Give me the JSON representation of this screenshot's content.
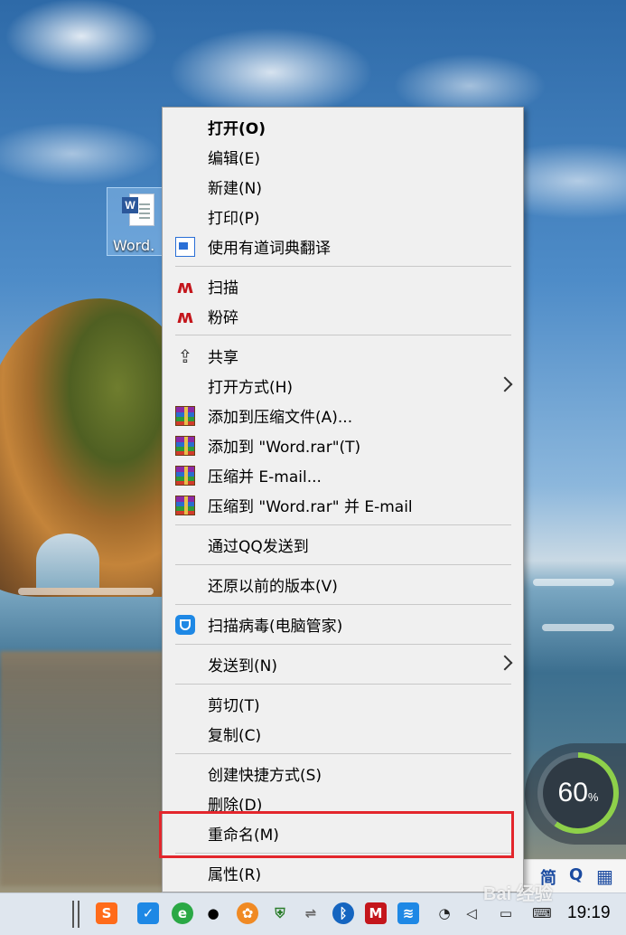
{
  "desktop": {
    "file_icon_label": "Word.",
    "file_badge": "W"
  },
  "menu": {
    "items": [
      {
        "label": "打开(O)",
        "bold": true,
        "icon": ""
      },
      {
        "label": "编辑(E)",
        "icon": ""
      },
      {
        "label": "新建(N)",
        "icon": ""
      },
      {
        "label": "打印(P)",
        "icon": ""
      },
      {
        "label": "使用有道词典翻译",
        "icon": "youdao-dict-icon"
      },
      {
        "label": "扫描",
        "icon": "mcafee-icon"
      },
      {
        "label": "粉碎",
        "icon": "mcafee-icon"
      },
      {
        "label": "共享",
        "icon": "share-icon"
      },
      {
        "label": "打开方式(H)",
        "icon": "",
        "submenu": true
      },
      {
        "label": "添加到压缩文件(A)...",
        "icon": "winrar-icon"
      },
      {
        "label": "添加到 \"Word.rar\"(T)",
        "icon": "winrar-icon"
      },
      {
        "label": "压缩并 E-mail...",
        "icon": "winrar-icon"
      },
      {
        "label": "压缩到 \"Word.rar\" 并 E-mail",
        "icon": "winrar-icon"
      },
      {
        "label": "通过QQ发送到",
        "icon": ""
      },
      {
        "label": "还原以前的版本(V)",
        "icon": ""
      },
      {
        "label": "扫描病毒(电脑管家)",
        "icon": "tencent-pc-manager-icon"
      },
      {
        "label": "发送到(N)",
        "icon": "",
        "submenu": true
      },
      {
        "label": "剪切(T)",
        "icon": ""
      },
      {
        "label": "复制(C)",
        "icon": ""
      },
      {
        "label": "创建快捷方式(S)",
        "icon": ""
      },
      {
        "label": "删除(D)",
        "icon": ""
      },
      {
        "label": "重命名(M)",
        "icon": "",
        "highlighted": true
      },
      {
        "label": "属性(R)",
        "icon": ""
      }
    ],
    "highlight_color": "#e3262c"
  },
  "widget": {
    "percent": "60",
    "percent_sign": "%",
    "fill": 0.6,
    "accent": "#8ed04a"
  },
  "langbar": {
    "ime_label": "简",
    "search_glyph": "Q"
  },
  "taskbar": {
    "clock": "19:19",
    "icons": [
      "sogou-input-icon",
      "tencent-pc-manager-icon",
      "ie-browser-icon",
      "qq-icon",
      "game-center-icon",
      "windows-defender-icon",
      "network-transfer-icon",
      "bluetooth-icon",
      "mcafee-icon",
      "audio-icon",
      "wifi-icon",
      "volume-icon",
      "notification-icon",
      "keyboard-icon"
    ],
    "sogou_label": "S"
  },
  "watermark": {
    "text": "Bai 经验"
  }
}
